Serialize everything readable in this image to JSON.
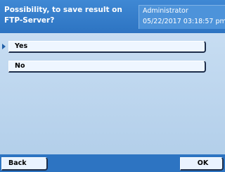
{
  "header": {
    "title": "Possibility, to save result on\nFTP-Server?",
    "user": "Administrator",
    "datetime": "05/22/2017 03:18:57 pm"
  },
  "options": [
    {
      "label": "Yes",
      "selected": true
    },
    {
      "label": "No",
      "selected": false
    }
  ],
  "footer": {
    "back_label": "Back",
    "ok_label": "OK"
  },
  "colors": {
    "header_blue": "#2d74c2",
    "content_bg": "#c0d8f0",
    "button_bg": "#eaf3ff"
  }
}
